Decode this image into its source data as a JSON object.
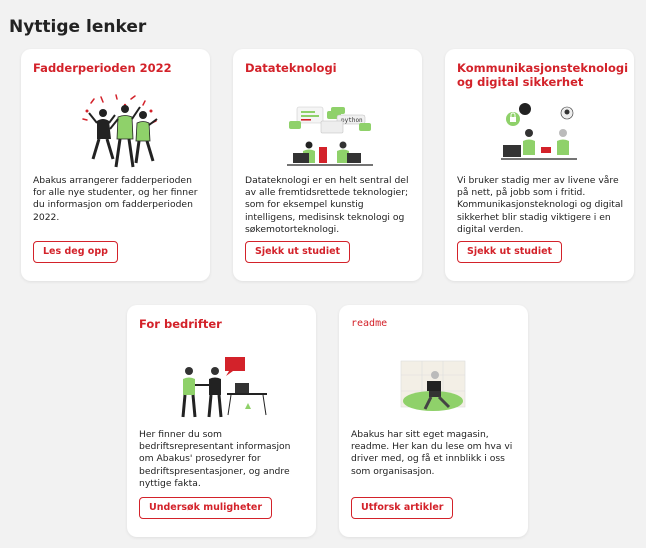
{
  "page": {
    "title": "Nyttige lenker"
  },
  "cards": [
    {
      "title": "Fadderperioden 2022",
      "description": "Abakus arrangerer fadderperioden for alle nye studenter, og her finner du informasjon om fadderperioden 2022.",
      "button": "Les deg opp",
      "illustration": "celebrating-people-illustration"
    },
    {
      "title": "Datateknologi",
      "description": "Datateknologi er en helt sentral del av alle fremtidsrettede teknologier; som for eksempel kunstig intelligens, medisinsk teknologi og søkemotorteknologi.",
      "button": "Sjekk ut studiet",
      "illustration": "programmers-illustration"
    },
    {
      "title": "Kommunikasjonsteknologi og digital sikkerhet",
      "description": "Vi bruker stadig mer av livene våre på nett, på jobb som i fritid. Kommunikasjonsteknologi og digital sikkerhet blir stadig viktigere i en digital verden.",
      "button": "Sjekk ut studiet",
      "illustration": "security-illustration"
    },
    {
      "title": "For bedrifter",
      "description": "Her finner du som bedriftsrepresentant informasjon om Abakus' prosedyrer for bedriftspresentasjoner, og andre nyttige fakta.",
      "button": "Undersøk muligheter",
      "illustration": "handshake-illustration"
    },
    {
      "title": "readme",
      "description": "Abakus har sitt eget magasin, readme. Her kan du lese om hva vi driver med, og få et innblikk i oss som organisasjon.",
      "button": "Utforsk artikler",
      "illustration": "reading-person-illustration"
    }
  ],
  "illustration_labels": {
    "python": "python"
  },
  "colors": {
    "accent": "#d3222a",
    "green": "#8fd16a",
    "background": "#f2f2f2"
  }
}
